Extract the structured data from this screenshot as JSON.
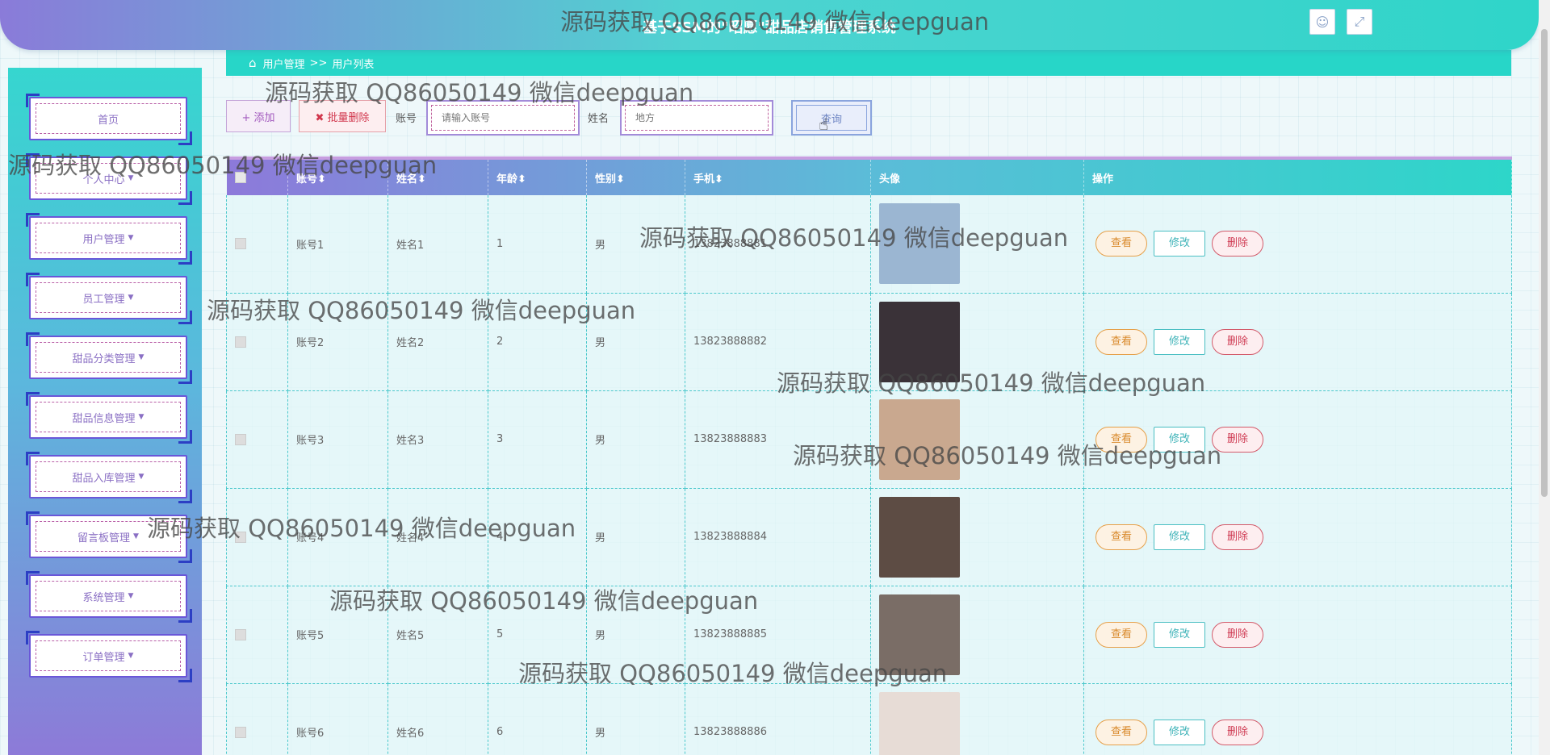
{
  "header": {
    "title": "基于SSM的\"昭愿\"甜品店销售管理系统",
    "user_icon": "user-icon",
    "fullscreen_icon": "fullscreen-icon"
  },
  "sidebar": {
    "items": [
      {
        "label": "首页",
        "has_caret": false
      },
      {
        "label": "个人中心",
        "has_caret": true
      },
      {
        "label": "用户管理",
        "has_caret": true
      },
      {
        "label": "员工管理",
        "has_caret": true
      },
      {
        "label": "甜品分类管理",
        "has_caret": true
      },
      {
        "label": "甜品信息管理",
        "has_caret": true
      },
      {
        "label": "甜品入库管理",
        "has_caret": true
      },
      {
        "label": "留言板管理",
        "has_caret": true
      },
      {
        "label": "系统管理",
        "has_caret": true
      },
      {
        "label": "订单管理",
        "has_caret": true
      }
    ]
  },
  "breadcrumb": {
    "home_icon": "home-icon",
    "level1": "用户管理",
    "separator": ">>",
    "level2": "用户列表"
  },
  "toolbar": {
    "add_label": "+ 添加",
    "batch_delete_label": "✖ 批量删除",
    "account_label": "账号",
    "account_placeholder": "请输入账号",
    "name_label": "姓名",
    "name_placeholder": "地方",
    "search_label": "查询"
  },
  "table": {
    "headers": [
      "",
      "账号",
      "姓名",
      "年龄",
      "性别",
      "手机",
      "头像",
      "操作"
    ],
    "sort_marker": "⬍",
    "rows": [
      {
        "account": "账号1",
        "name": "姓名1",
        "age": "1",
        "gender": "男",
        "phone": "13823888881",
        "avatar_color": "#9bb6d2"
      },
      {
        "account": "账号2",
        "name": "姓名2",
        "age": "2",
        "gender": "男",
        "phone": "13823888882",
        "avatar_color": "#3a3238"
      },
      {
        "account": "账号3",
        "name": "姓名3",
        "age": "3",
        "gender": "男",
        "phone": "13823888883",
        "avatar_color": "#c9a88f"
      },
      {
        "account": "账号4",
        "name": "姓名4",
        "age": "4",
        "gender": "男",
        "phone": "13823888884",
        "avatar_color": "#5d4c44"
      },
      {
        "account": "账号5",
        "name": "姓名5",
        "age": "5",
        "gender": "男",
        "phone": "13823888885",
        "avatar_color": "#7a6d66"
      },
      {
        "account": "账号6",
        "name": "姓名6",
        "age": "6",
        "gender": "男",
        "phone": "13823888886",
        "avatar_color": "#e7dcd6"
      }
    ],
    "actions": {
      "view": "查看",
      "edit": "修改",
      "delete": "删除"
    }
  },
  "watermark": "源码获取 QQ86050149 微信deepguan"
}
